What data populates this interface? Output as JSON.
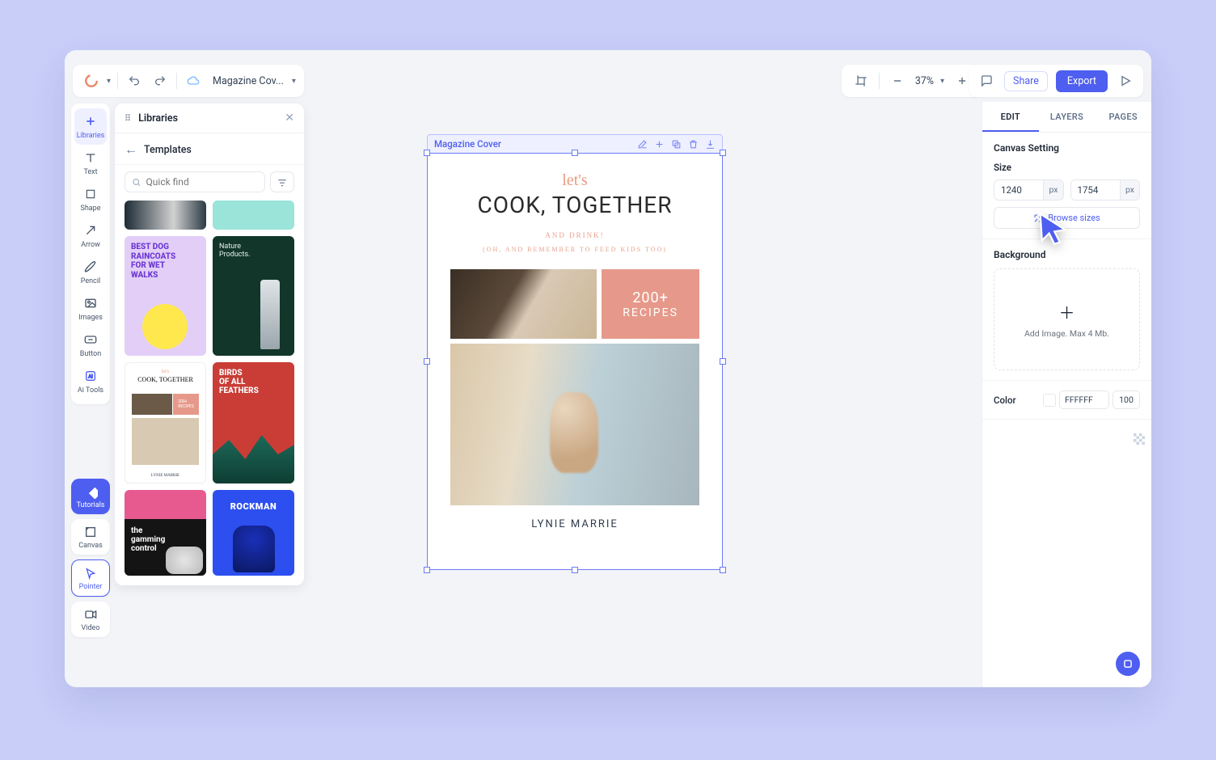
{
  "document": {
    "name": "Magazine Cov..."
  },
  "topbar": {
    "zoom": "37%",
    "share": "Share",
    "export": "Export"
  },
  "tools": [
    {
      "id": "libraries",
      "label": "Libraries",
      "active": true
    },
    {
      "id": "text",
      "label": "Text"
    },
    {
      "id": "shape",
      "label": "Shape"
    },
    {
      "id": "arrow",
      "label": "Arrow"
    },
    {
      "id": "pencil",
      "label": "Pencil"
    },
    {
      "id": "images",
      "label": "Images"
    },
    {
      "id": "button",
      "label": "Button"
    },
    {
      "id": "ai",
      "label": "Ai Tools"
    }
  ],
  "tools2": [
    {
      "id": "tutorials",
      "label": "Tutorials",
      "accent": true
    },
    {
      "id": "canvas",
      "label": "Canvas"
    },
    {
      "id": "pointer",
      "label": "Pointer",
      "active_outline": true
    },
    {
      "id": "video",
      "label": "Video"
    }
  ],
  "libraries": {
    "title": "Libraries",
    "subtitle": "Templates",
    "search_placeholder": "Quick find"
  },
  "canvas": {
    "label": "Magazine Cover",
    "cover": {
      "lets": "let's",
      "title": "COOK, TOGETHER",
      "sub1": "AND DRINK!",
      "sub2": "(OH, AND REMEMBER TO FEED KIDS TOO)",
      "badge_top": "200+",
      "badge_bot": "RECIPES",
      "author": "LYNIE MARRIE"
    }
  },
  "right": {
    "tabs": {
      "edit": "EDIT",
      "layers": "LAYERS",
      "pages": "PAGES"
    },
    "canvas_setting": "Canvas Setting",
    "size_label": "Size",
    "width": "1240",
    "height": "1754",
    "unit": "px",
    "browse_sizes": "Browse sizes",
    "background_label": "Background",
    "add_image": "Add Image. Max 4 Mb.",
    "color_label": "Color",
    "hex": "FFFFFF",
    "opacity": "100"
  }
}
